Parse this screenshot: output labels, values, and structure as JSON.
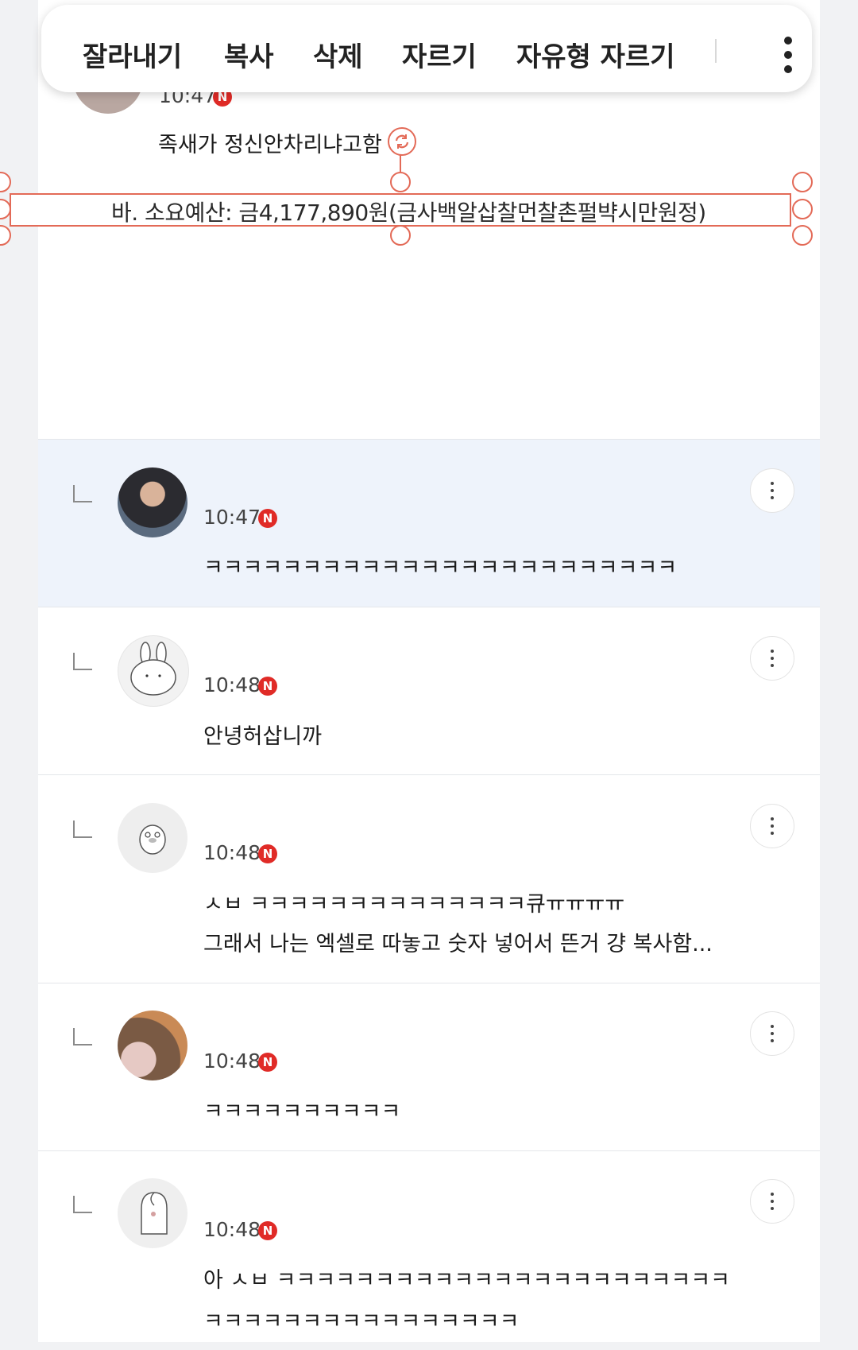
{
  "toolbar": {
    "items": [
      "잘라내기",
      "복사",
      "삭제",
      "자르기",
      "자유형 자르기"
    ],
    "more_icon": "more-vertical-icon"
  },
  "top_post": {
    "time": "10:47",
    "badge": "N",
    "message": "족새가 정신안차리냐고함",
    "selected_text": "바.  소요예산:  금4,177,890원(금사백알삽찰먼찰촌펄뱍시만원정)"
  },
  "comments": [
    {
      "time": "10:47",
      "badge": "N",
      "lines": [
        "ㅋㅋㅋㅋㅋㅋㅋㅋㅋㅋㅋㅋㅋㅋㅋㅋㅋㅋㅋㅋㅋㅋㅋㅋ"
      ]
    },
    {
      "time": "10:48",
      "badge": "N",
      "lines": [
        "안녕허삽니까"
      ]
    },
    {
      "time": "10:48",
      "badge": "N",
      "lines": [
        "ㅅㅂ ㅋㅋㅋㅋㅋㅋㅋㅋㅋㅋㅋㅋㅋㅋ큐ㅠㅠㅠㅠ",
        "그래서 나는 엑셀로 따놓고 숫자 넣어서 뜬거 걍 복사함..."
      ]
    },
    {
      "time": "10:48",
      "badge": "N",
      "lines": [
        "ㅋㅋㅋㅋㅋㅋㅋㅋㅋㅋ"
      ]
    },
    {
      "time": "10:48",
      "badge": "N",
      "lines": [
        "아 ㅅㅂ ㅋㅋㅋㅋㅋㅋㅋㅋㅋㅋㅋㅋㅋㅋㅋㅋㅋㅋㅋㅋㅋㅋㅋ",
        "ㅋㅋㅋㅋㅋㅋㅋㅋㅋㅋㅋㅋㅋㅋㅋㅋ"
      ]
    }
  ]
}
